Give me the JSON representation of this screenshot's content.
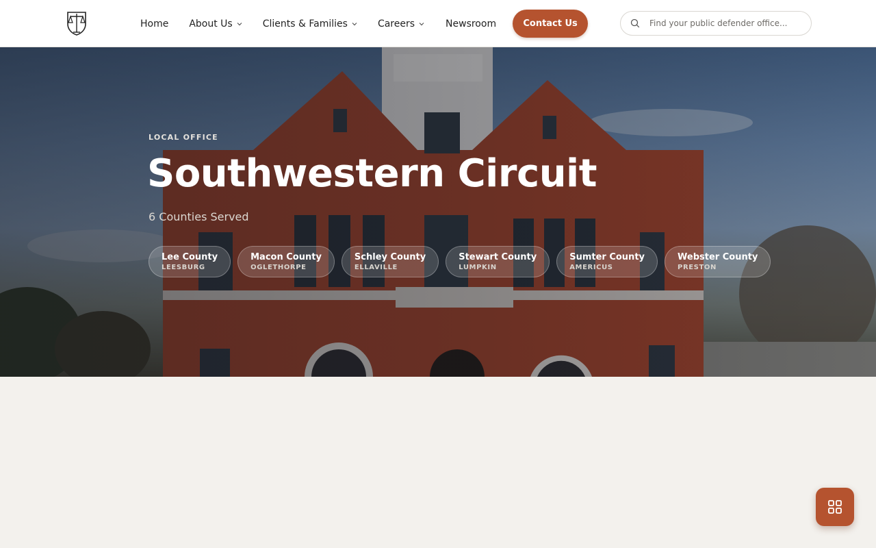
{
  "header": {
    "logo_icon": "scales-of-justice-shield-icon",
    "nav": {
      "home": "Home",
      "about": "About Us",
      "clients": "Clients & Families",
      "careers": "Careers",
      "newsroom": "Newsroom"
    },
    "contact_label": "Contact Us",
    "search": {
      "placeholder": "Find your public defender office...",
      "value": "",
      "icon": "search-icon"
    }
  },
  "hero": {
    "eyebrow": "LOCAL OFFICE",
    "title": "Southwestern Circuit",
    "subtitle": "6 Counties Served",
    "counties": [
      {
        "name": "Lee County",
        "city": "LEESBURG"
      },
      {
        "name": "Macon County",
        "city": "OGLETHORPE"
      },
      {
        "name": "Schley County",
        "city": "ELLAVILLE"
      },
      {
        "name": "Stewart County",
        "city": "LUMPKIN"
      },
      {
        "name": "Sumter County",
        "city": "AMERICUS"
      },
      {
        "name": "Webster County",
        "city": "PRESTON"
      }
    ]
  },
  "fab": {
    "icon": "grid-menu-icon"
  },
  "colors": {
    "accent": "#b5532f",
    "page_background": "#f3f1ed",
    "header_background": "#ffffff"
  }
}
